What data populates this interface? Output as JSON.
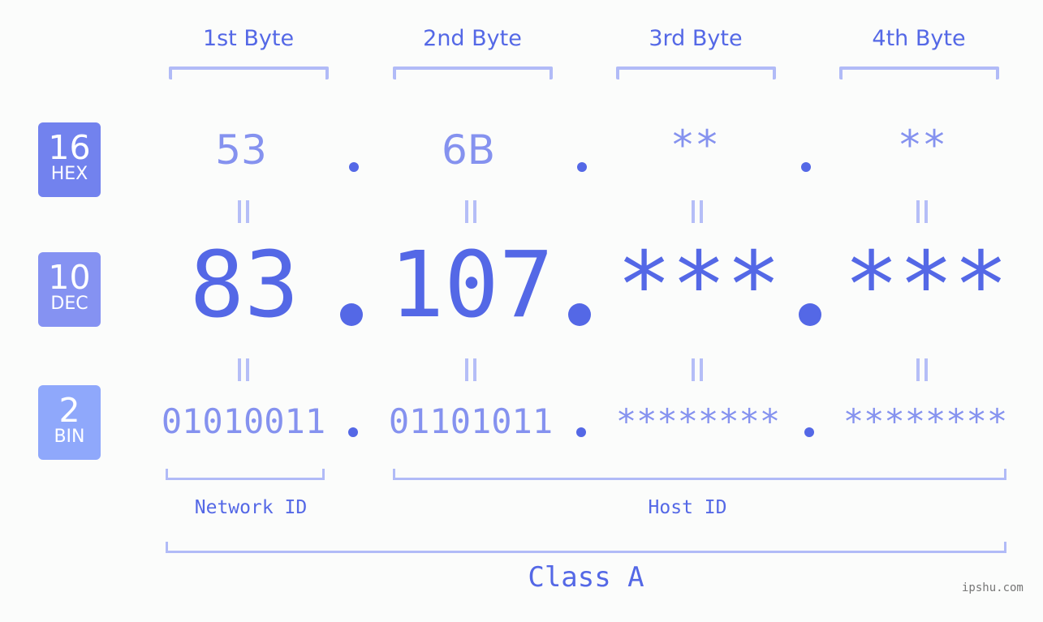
{
  "bytes": [
    {
      "label": "1st Byte",
      "hex": "53",
      "dec": "83",
      "bin": "01010011"
    },
    {
      "label": "2nd Byte",
      "hex": "6B",
      "dec": "107",
      "bin": "01101011"
    },
    {
      "label": "3rd Byte",
      "hex": "**",
      "dec": "***",
      "bin": "********"
    },
    {
      "label": "4th Byte",
      "hex": "**",
      "dec": "***",
      "bin": "********"
    }
  ],
  "bases": {
    "hex": {
      "num": "16",
      "label": "HEX",
      "color": "#7282ee"
    },
    "dec": {
      "num": "10",
      "label": "DEC",
      "color": "#8592f2"
    },
    "bin": {
      "num": "2",
      "label": "BIN",
      "color": "#8fa8fb"
    }
  },
  "network_id": "Network ID",
  "host_id": "Host ID",
  "class_label": "Class A",
  "watermark": "ipshu.com",
  "colors": {
    "accent": "#5468e6",
    "light": "#8592ef",
    "bracket": "#b1bbf7"
  }
}
